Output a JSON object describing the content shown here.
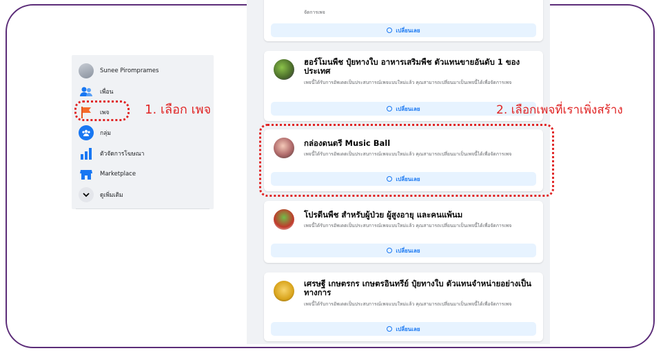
{
  "sidebar": {
    "user_name": "Sunee Piromprames",
    "items": [
      {
        "label": "เพื่อน"
      },
      {
        "label": "เพจ"
      },
      {
        "label": "กลุ่ม"
      },
      {
        "label": "ตัวจัดการโฆษณา"
      },
      {
        "label": "Marketplace"
      },
      {
        "label": "ดูเพิ่มเติม"
      }
    ]
  },
  "annotations": {
    "step1": "1. เลือก เพจ",
    "step2": "2. เลือกเพจที่เราเพิ่งสร้าง"
  },
  "colors": {
    "accent": "#1877f2",
    "annotation": "#e02424",
    "frame": "#5b2c78"
  },
  "feed": {
    "top_partial": {
      "desc_tail": "จัดการเพจ",
      "button": "เปลี่ยนเลย"
    },
    "pages": [
      {
        "title": "ฮอร์โมนพืช ปุ๋ยทางใบ อาหารเสริมพืช ตัวแทนขายอันดับ 1 ของประเทศ",
        "desc": "เพจนี้ได้รับการอัพเดตเป็นประสบการณ์เพจแบบใหม่แล้ว คุณสามารถเปลี่ยนมาเป็นเพจนี้ได้เพื่อจัดการเพจ",
        "button": "เปลี่ยนเลย"
      },
      {
        "title": "กล่องดนตรี Music Ball",
        "desc": "เพจนี้ได้รับการอัพเดตเป็นประสบการณ์เพจแบบใหม่แล้ว คุณสามารถเปลี่ยนมาเป็นเพจนี้ได้เพื่อจัดการเพจ",
        "button": "เปลี่ยนเลย"
      },
      {
        "title": "โปรตีนพืช สำหรับผู้ป่วย ผู้สูงอายุ และคนแพ้นม",
        "desc": "เพจนี้ได้รับการอัพเดตเป็นประสบการณ์เพจแบบใหม่แล้ว คุณสามารถเปลี่ยนมาเป็นเพจนี้ได้เพื่อจัดการเพจ",
        "button": "เปลี่ยนเลย"
      },
      {
        "title": "เศรษฐี เกษตรกร เกษตรอินทรีย์ ปุ๋ยทางใบ ตัวแทนจำหน่ายอย่างเป็นทางการ",
        "desc": "เพจนี้ได้รับการอัพเดตเป็นประสบการณ์เพจแบบใหม่แล้ว คุณสามารถเปลี่ยนมาเป็นเพจนี้ได้เพื่อจัดการเพจ",
        "button": "เปลี่ยนเลย"
      }
    ]
  }
}
